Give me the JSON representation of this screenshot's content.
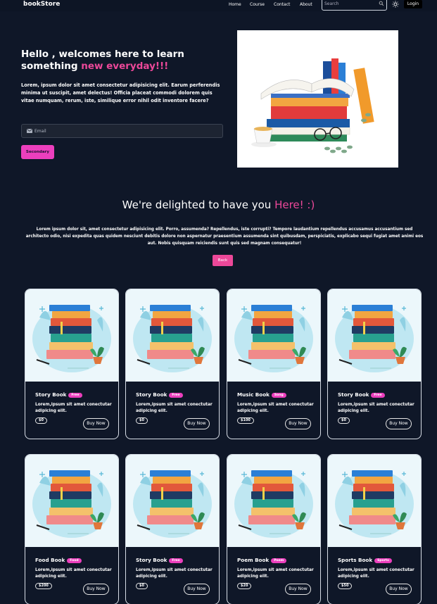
{
  "nav": {
    "brand": "bookStore",
    "menu": [
      "Home",
      "Course",
      "Contact",
      "About"
    ],
    "search_placeholder": "Search",
    "login_label": "Login"
  },
  "hero": {
    "title_prefix": "Hello , welcomes here to learn something ",
    "title_highlight": "new everyday!!!",
    "description": "Lorem, ipsum dolor sit amet consectetur adipisicing elit. Earum perferendis minima ut suscipit, amet delectus! Officia placeat commodi dolorem quis vitae numquam, rerum, iste, similique error nihil odit inventore facere?",
    "email_placeholder": "Email",
    "button_label": "Secondary"
  },
  "delight": {
    "title_prefix": "We're delighted to have you ",
    "title_highlight": "Here! :)",
    "text": "Lorem ipsum dolor sit, amet consectetur adipisicing elit. Porro, assumenda? Repellendus, iste corrupti? Tempore laudantium repellendus accusamus accusantium sed architecto odio, nisi expedita quas quidem nesciunt debitis dolore non aspernatur praesentium assumenda sint quibusdam, perspiciatis, explicabo sequi fugiat amet animi eos aut. Nobis quisquam reiciendis sunt quis sed magnam consequatur!",
    "button_label": "Back"
  },
  "cards": [
    {
      "title": "Story Book",
      "badge": "Free",
      "desc": "Lorem,ipsum sit amet conectutar adipicing elit.",
      "price": "$0",
      "buy": "Buy Now"
    },
    {
      "title": "Story Book",
      "badge": "Free",
      "desc": "Lorem,ipsum sit amet conectutar adipicing elit.",
      "price": "$0",
      "buy": "Buy Now"
    },
    {
      "title": "Music Book",
      "badge": "Song",
      "desc": "Lorem,ipsum sit amet conectutar adipicing elit.",
      "price": "$100",
      "buy": "Buy Now"
    },
    {
      "title": "Story Book",
      "badge": "Free",
      "desc": "Lorem,ipsum sit amet conectutar adipicing elit.",
      "price": "$0",
      "buy": "Buy Now"
    },
    {
      "title": "Food Book",
      "badge": "Food",
      "desc": "Lorem,ipsum sit amet conectutar adipicing elit.",
      "price": "$200",
      "buy": "Buy Now"
    },
    {
      "title": "Story Book",
      "badge": "Free",
      "desc": "Lorem,ipsum sit amet conectutar adipicing elit.",
      "price": "$0",
      "buy": "Buy Now"
    },
    {
      "title": "Poem Book",
      "badge": "Poem",
      "desc": "Lorem,ipsum sit amet conectutar adipicing elit.",
      "price": "$20",
      "buy": "Buy Now"
    },
    {
      "title": "Sports Book",
      "badge": "Sports",
      "desc": "Lorem,ipsum sit amet conectutar adipicing elit.",
      "price": "$50",
      "buy": "Buy Now"
    }
  ],
  "colors": {
    "background": "#0f1728",
    "accent_pink": "#ec4899",
    "button_pink": "#ec3fbd"
  }
}
